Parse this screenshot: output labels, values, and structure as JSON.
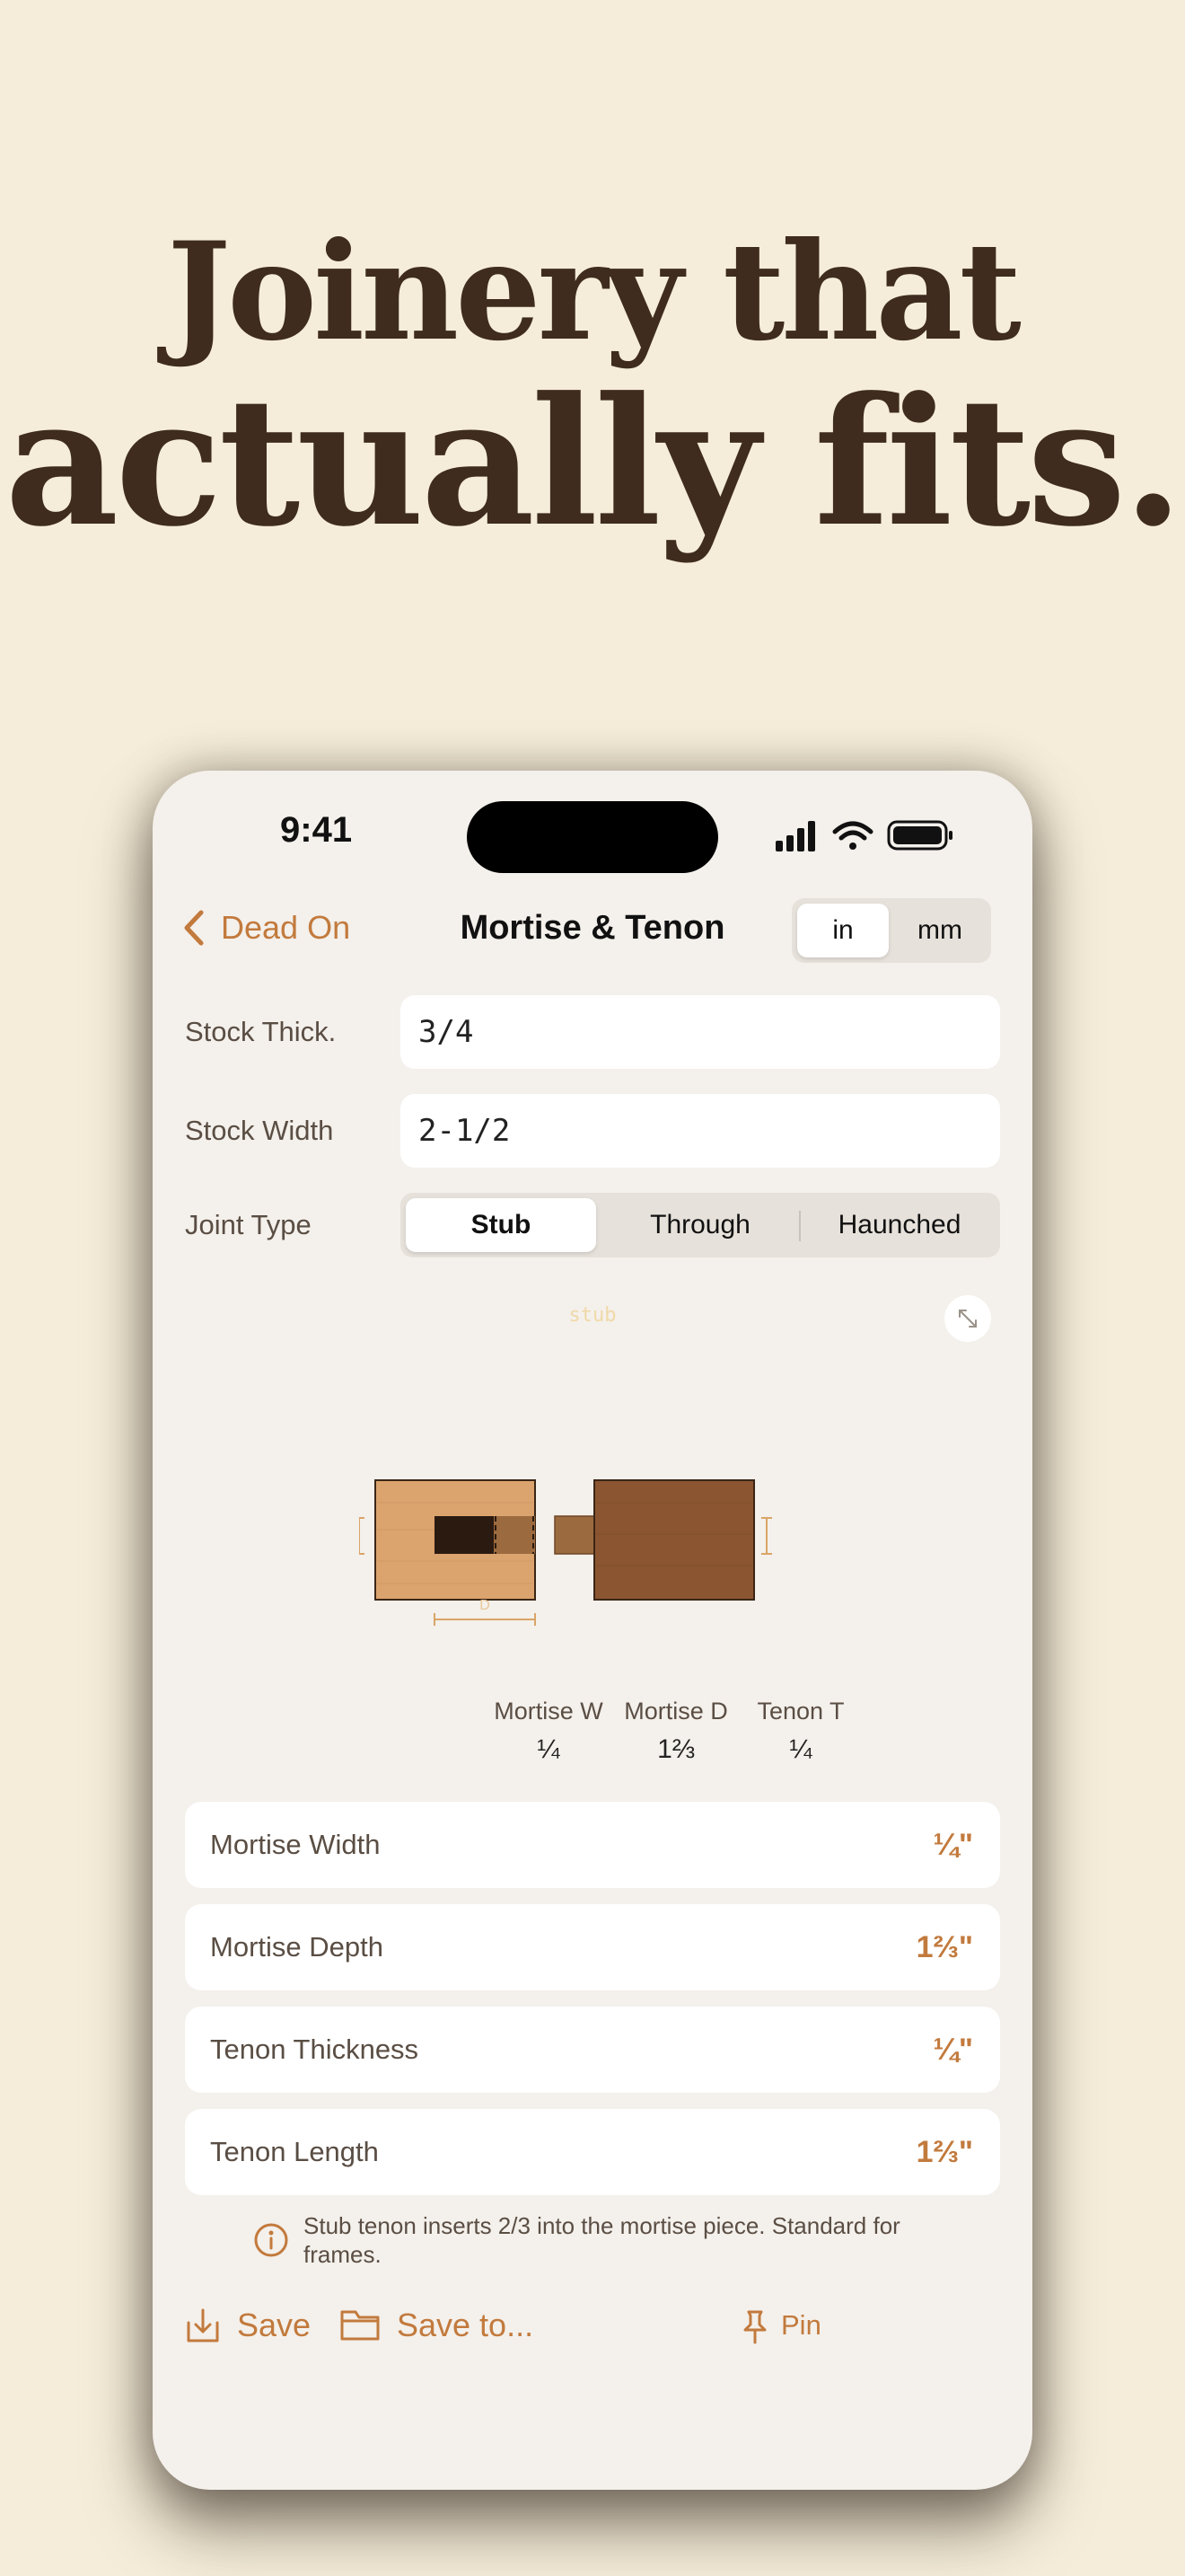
{
  "headline": {
    "line1": "Joinery that",
    "line2": "actually fits."
  },
  "status": {
    "time": "9:41"
  },
  "nav": {
    "back_label": "Dead On",
    "title": "Mortise & Tenon"
  },
  "units": {
    "options": [
      "in",
      "mm"
    ],
    "selected": "in"
  },
  "fields": {
    "stock_thick": {
      "label": "Stock Thick.",
      "value": "3/4"
    },
    "stock_width": {
      "label": "Stock Width",
      "value": "2-1/2"
    }
  },
  "joint": {
    "label": "Joint Type",
    "options": [
      "Stub",
      "Through",
      "Haunched"
    ],
    "selected": "Stub"
  },
  "diagram": {
    "tag": "stub",
    "depth_label": "D"
  },
  "dims": [
    {
      "label": "Mortise W",
      "value": "¼"
    },
    {
      "label": "Mortise D",
      "value": "1⅔"
    },
    {
      "label": "Tenon T",
      "value": "¼"
    }
  ],
  "results": [
    {
      "label": "Mortise Width",
      "value": "¼\""
    },
    {
      "label": "Mortise Depth",
      "value": "1⅔\""
    },
    {
      "label": "Tenon Thickness",
      "value": "¼\""
    },
    {
      "label": "Tenon Length",
      "value": "1⅔\""
    }
  ],
  "info": {
    "text": "Stub tenon inserts 2/3 into the mortise piece. Standard for frames."
  },
  "actions": {
    "save": "Save",
    "save_to": "Save to...",
    "pin": "Pin"
  },
  "colors": {
    "accent": "#C27A3D",
    "background": "#F5EDD9",
    "headline": "#3F2C1E",
    "wood_light": "#DBA36E",
    "wood_dark": "#8A5530"
  }
}
